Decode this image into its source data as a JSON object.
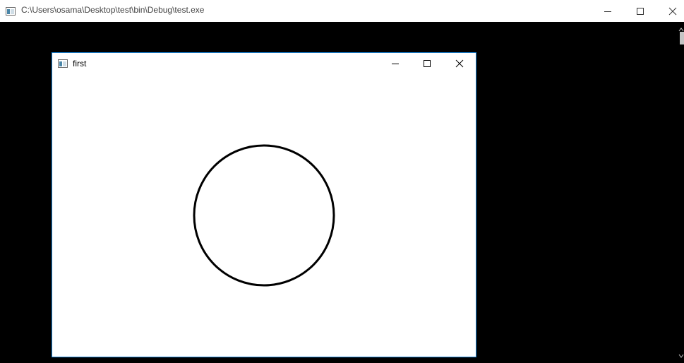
{
  "console_window": {
    "title": "C:\\Users\\osama\\Desktop\\test\\bin\\Debug\\test.exe",
    "app_icon": "console-app-icon",
    "buttons": {
      "minimize_icon": "minimize-icon",
      "maximize_icon": "maximize-icon",
      "close_icon": "close-icon"
    },
    "background_color": "#000000"
  },
  "graphics_window": {
    "title": "first",
    "app_icon": "window-app-icon",
    "buttons": {
      "minimize_icon": "minimize-icon",
      "maximize_icon": "maximize-icon",
      "close_icon": "close-icon"
    },
    "border_color": "#1883d7",
    "background_color": "#ffffff",
    "drawing": {
      "shape": "circle",
      "stroke_color": "#000000",
      "fill": "none"
    }
  }
}
